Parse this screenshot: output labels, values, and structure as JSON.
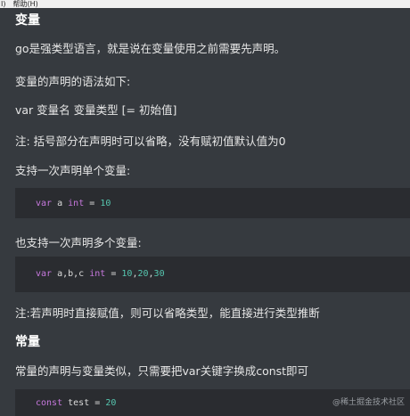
{
  "menubar": {
    "items": [
      "I)",
      "帮助(H)"
    ]
  },
  "article": {
    "heading_var": "变量",
    "p1": "go是强类型语言，就是说在变量使用之前需要先声明。",
    "p2": "变量的声明的语法如下:",
    "syntax": "var  变量名  变量类型  [= 初始值]",
    "note1": "注: 括号部分在声明时可以省略，没有赋初值默认值为0",
    "p3": "支持一次声明单个变量:",
    "code1": {
      "kw": "var",
      "name": "a",
      "type": "int",
      "eq": "=",
      "val": "10"
    },
    "p4": "也支持一次声明多个变量:",
    "code2": {
      "kw": "var",
      "names": "a,b,c",
      "type": "int",
      "eq": "=",
      "val1": "10",
      "sep1": ",",
      "val2": "20",
      "sep2": ",",
      "val3": "30"
    },
    "note2": "注:若声明时直接赋值，则可以省略类型，能直接进行类型推断",
    "heading_const": "常量",
    "p5": "常量的声明与变量类似，只需要把var关键字换成const即可",
    "code3": {
      "kw": "const",
      "name": "test",
      "eq": "=",
      "val": "20"
    }
  },
  "watermark": "@稀土掘金技术社区"
}
